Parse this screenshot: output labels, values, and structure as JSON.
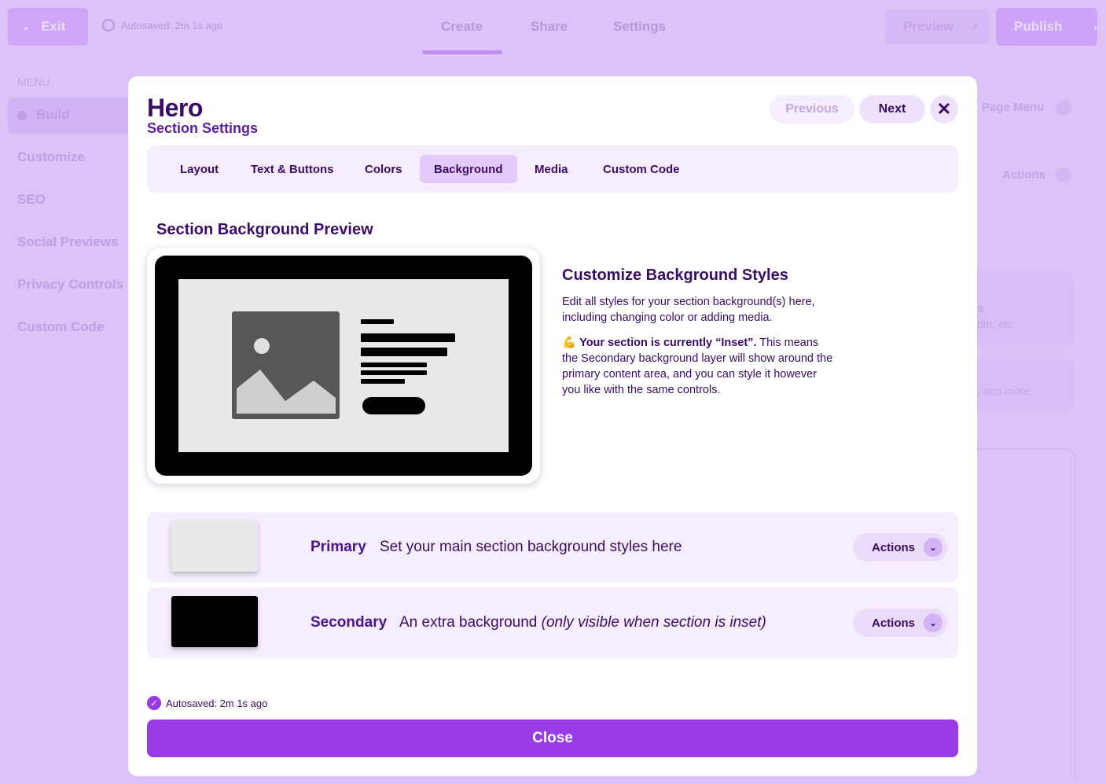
{
  "topbar": {
    "exit_label": "Exit",
    "autosave": "Autosaved: 2m 1s ago",
    "tabs": [
      "Create",
      "Share",
      "Settings"
    ],
    "preview_label": "Preview",
    "publish_label": "Publish"
  },
  "sidebar": {
    "title": "MENU",
    "items": [
      "Build",
      "Customize",
      "SEO",
      "Social Previews",
      "Privacy Controls",
      "Custom Code"
    ]
  },
  "right_panel": {
    "page_menu": "Page Menu",
    "actions": "Actions",
    "card1_frag_a": "s",
    "card1_frag_b": "dth, etc.",
    "card2_frag": ", and more"
  },
  "modal": {
    "title": "Hero",
    "subtitle": "Section Settings",
    "previous_label": "Previous",
    "next_label": "Next",
    "close_x": "✕",
    "tabs": [
      {
        "label": "Layout"
      },
      {
        "label": "Text & Buttons"
      },
      {
        "label": "Colors"
      },
      {
        "label": "Background"
      },
      {
        "label": "Media"
      },
      {
        "label": "Custom Code"
      }
    ],
    "active_tab": "Background",
    "preview_heading": "Section Background Preview",
    "info_title": "Customize Background Styles",
    "info_p1": "Edit all styles for your section background(s) here, including changing color or adding media.",
    "info_p2_emoji": "💪",
    "info_p2_bold": "Your section is currently “Inset”.",
    "info_p2_rest": " This means the Secondary background layer will show around the primary content area, and you can style it however you like with the same controls.",
    "rows": [
      {
        "name": "Primary",
        "desc": "Set your main section background styles here",
        "desc_italic": "",
        "swatch": "#e9e9e9",
        "actions": "Actions"
      },
      {
        "name": "Secondary",
        "desc": "An extra background ",
        "desc_italic": "(only visible when section is inset)",
        "swatch": "#000000",
        "actions": "Actions"
      }
    ],
    "autosave": "Autosaved: 2m 1s ago",
    "close_label": "Close"
  },
  "colors": {
    "accent": "#9a3be8",
    "text": "#3b0b66",
    "tab_active": "#e3ccfb",
    "panel_bg": "#f6eefe",
    "overlay": "#dcc2f7"
  },
  "icons": {
    "exit": "chevron-down-icon",
    "autosave": "check-circle-icon",
    "preview": "external-link-icon",
    "publish": "chevron-right-icon",
    "close": "close-icon",
    "actions": "chevron-down-icon"
  }
}
